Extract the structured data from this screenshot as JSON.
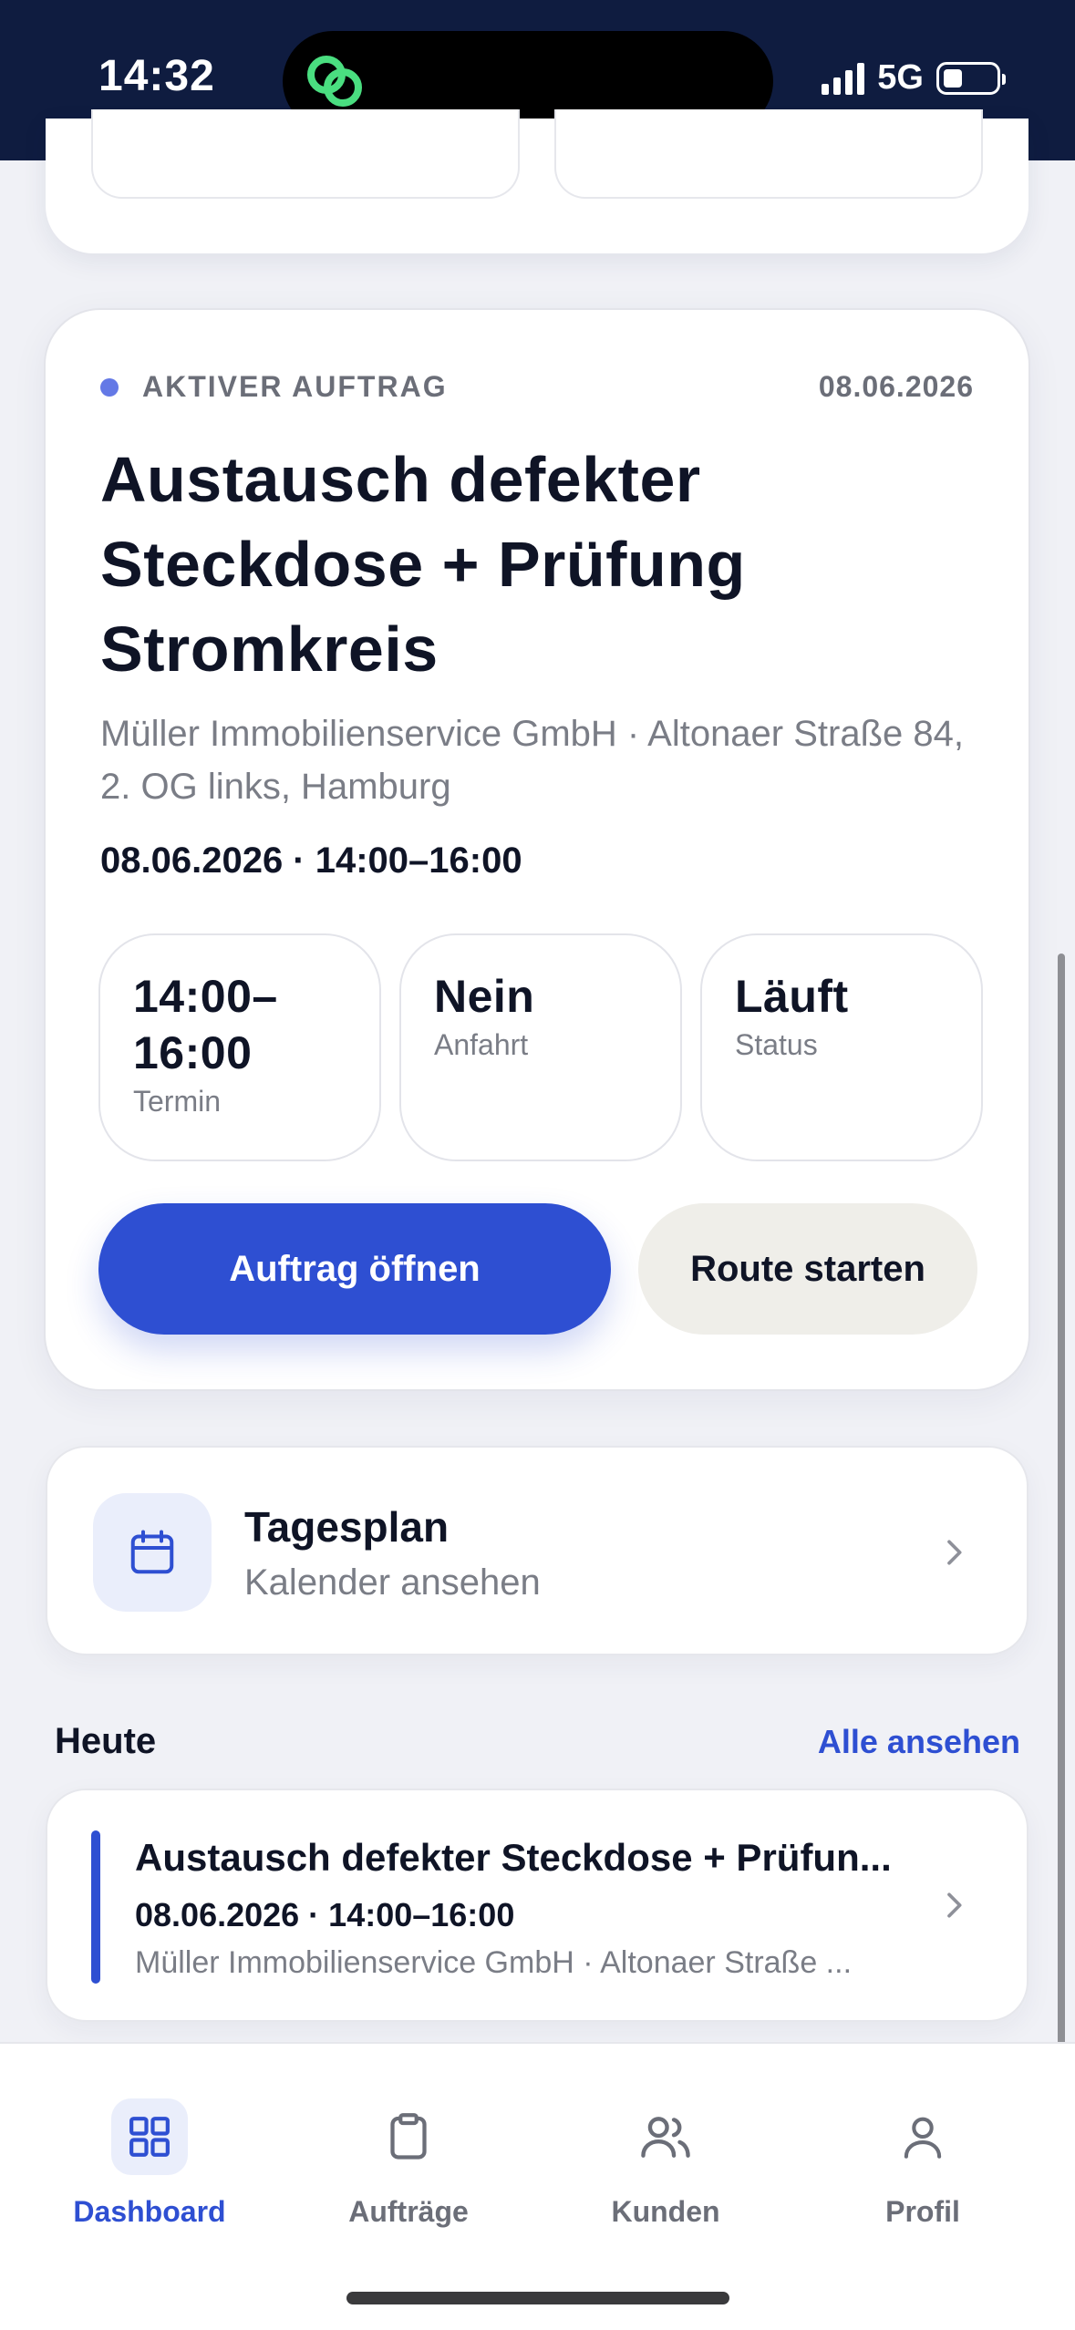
{
  "status_bar": {
    "time": "14:32",
    "network": "5G"
  },
  "active_job": {
    "kicker": "AKTIVER AUFTRAG",
    "date": "08.06.2026",
    "title": "Austausch defekter Steckdose + Prüfung Stromkreis",
    "subtitle": "Müller Immobilienservice GmbH · Altonaer Straße 84, 2. OG links, Hamburg",
    "when": "08.06.2026 · 14:00–16:00",
    "stats": [
      {
        "value": "14:00–16:00",
        "label": "Termin"
      },
      {
        "value": "Nein",
        "label": "Anfahrt"
      },
      {
        "value": "Läuft",
        "label": "Status"
      }
    ],
    "primary_button": "Auftrag öffnen",
    "secondary_button": "Route starten"
  },
  "plan": {
    "title": "Tagesplan",
    "subtitle": "Kalender ansehen"
  },
  "today": {
    "heading": "Heute",
    "link": "Alle ansehen",
    "item": {
      "title": "Austausch defekter Steckdose + Prüfun...",
      "when": "08.06.2026 · 14:00–16:00",
      "subtitle": "Müller Immobilienservice GmbH · Altonaer Straße ..."
    }
  },
  "tabs": [
    {
      "label": "Dashboard",
      "icon": "grid-icon",
      "active": true
    },
    {
      "label": "Aufträge",
      "icon": "clipboard-icon",
      "active": false
    },
    {
      "label": "Kunden",
      "icon": "users-icon",
      "active": false
    },
    {
      "label": "Profil",
      "icon": "user-icon",
      "active": false
    }
  ],
  "colors": {
    "accent": "#2e4fd2",
    "header": "#0f1c40",
    "background": "#f0f1f6"
  }
}
